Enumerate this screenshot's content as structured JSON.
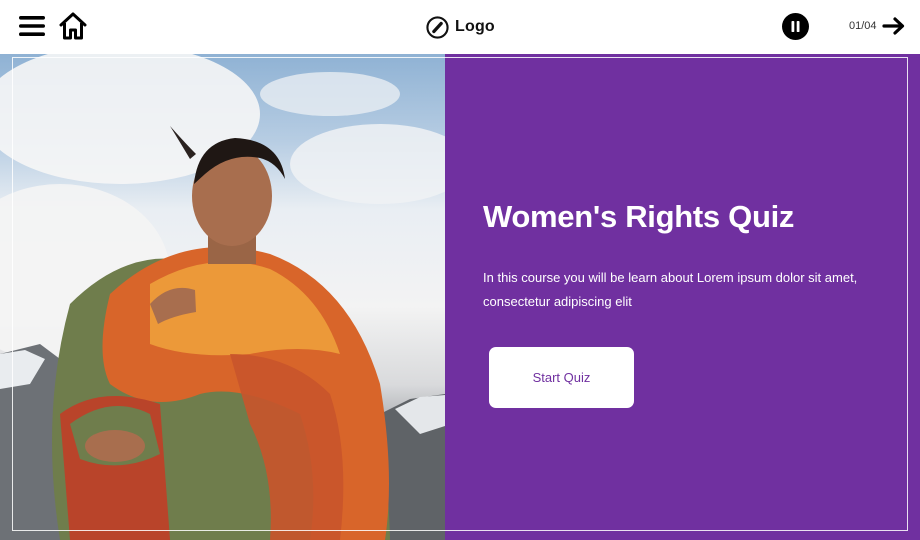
{
  "header": {
    "menu_icon": "hamburger-menu-icon",
    "home_icon": "home-icon",
    "logo_icon": "circle-slash-icon",
    "logo_text": "Logo",
    "pause_icon": "pause-icon",
    "page_counter": "01/04",
    "next_icon": "arrow-right-icon"
  },
  "hero": {
    "image_alt": "Woman in a colorful floral shawl standing in front of snowy mountains",
    "title": "Women's Rights Quiz",
    "description": "In this course you will be learn about Lorem ipsum dolor sit amet, consectetur adipiscing elit",
    "start_button_label": "Start Quiz"
  },
  "colors": {
    "panel_background": "#7030a0",
    "button_background": "#ffffff",
    "button_text": "#7030a0",
    "header_background": "#ffffff"
  }
}
